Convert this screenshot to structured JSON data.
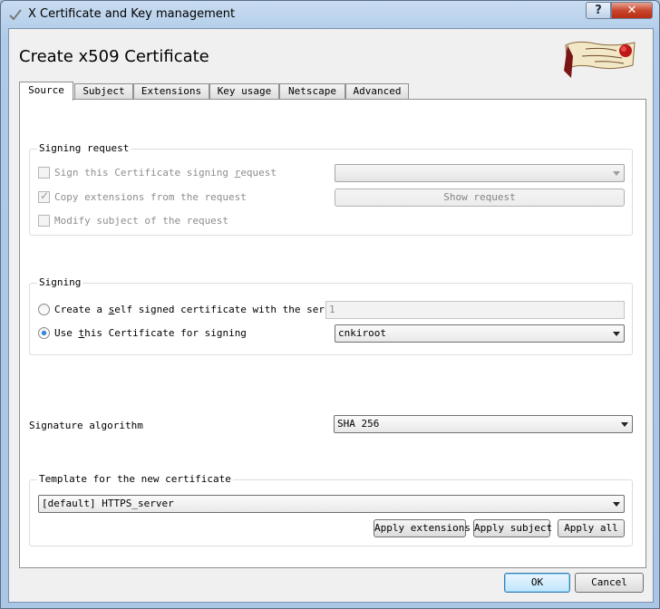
{
  "window": {
    "title": "X Certificate and Key management",
    "help_label": "?",
    "close_label": "✕"
  },
  "header": {
    "title": "Create x509 Certificate"
  },
  "tabs": [
    {
      "label": "Source"
    },
    {
      "label": "Subject"
    },
    {
      "label": "Extensions"
    },
    {
      "label": "Key usage"
    },
    {
      "label": "Netscape"
    },
    {
      "label": "Advanced"
    }
  ],
  "signing_request": {
    "title": "Signing request",
    "sign_csr_label_pre": "Sign this Certificate signing ",
    "sign_csr_label_ul": "r",
    "sign_csr_label_post": "equest",
    "request_combo_value": "",
    "copy_ext_label": "Copy extensions from the request",
    "show_request_label": "Show request",
    "modify_subject_label": "Modify subject of the request"
  },
  "signing": {
    "title": "Signing",
    "self_signed_pre": "Create a ",
    "self_signed_ul": "s",
    "self_signed_post": "elf signed certificate with the serial",
    "serial_value": "1",
    "use_cert_pre": "Use ",
    "use_cert_ul": "t",
    "use_cert_post": "his Certificate for signing",
    "ca_value": "cnkiroot"
  },
  "signature": {
    "label": "Signature algorithm",
    "value": "SHA 256"
  },
  "template": {
    "title": "Template for the new certificate",
    "value": "[default] HTTPS_server",
    "apply_extensions_label": "Apply extensions",
    "apply_subject_label": "Apply subject",
    "apply_all_label": "Apply all"
  },
  "footer": {
    "ok_label": "OK",
    "cancel_label": "Cancel"
  }
}
